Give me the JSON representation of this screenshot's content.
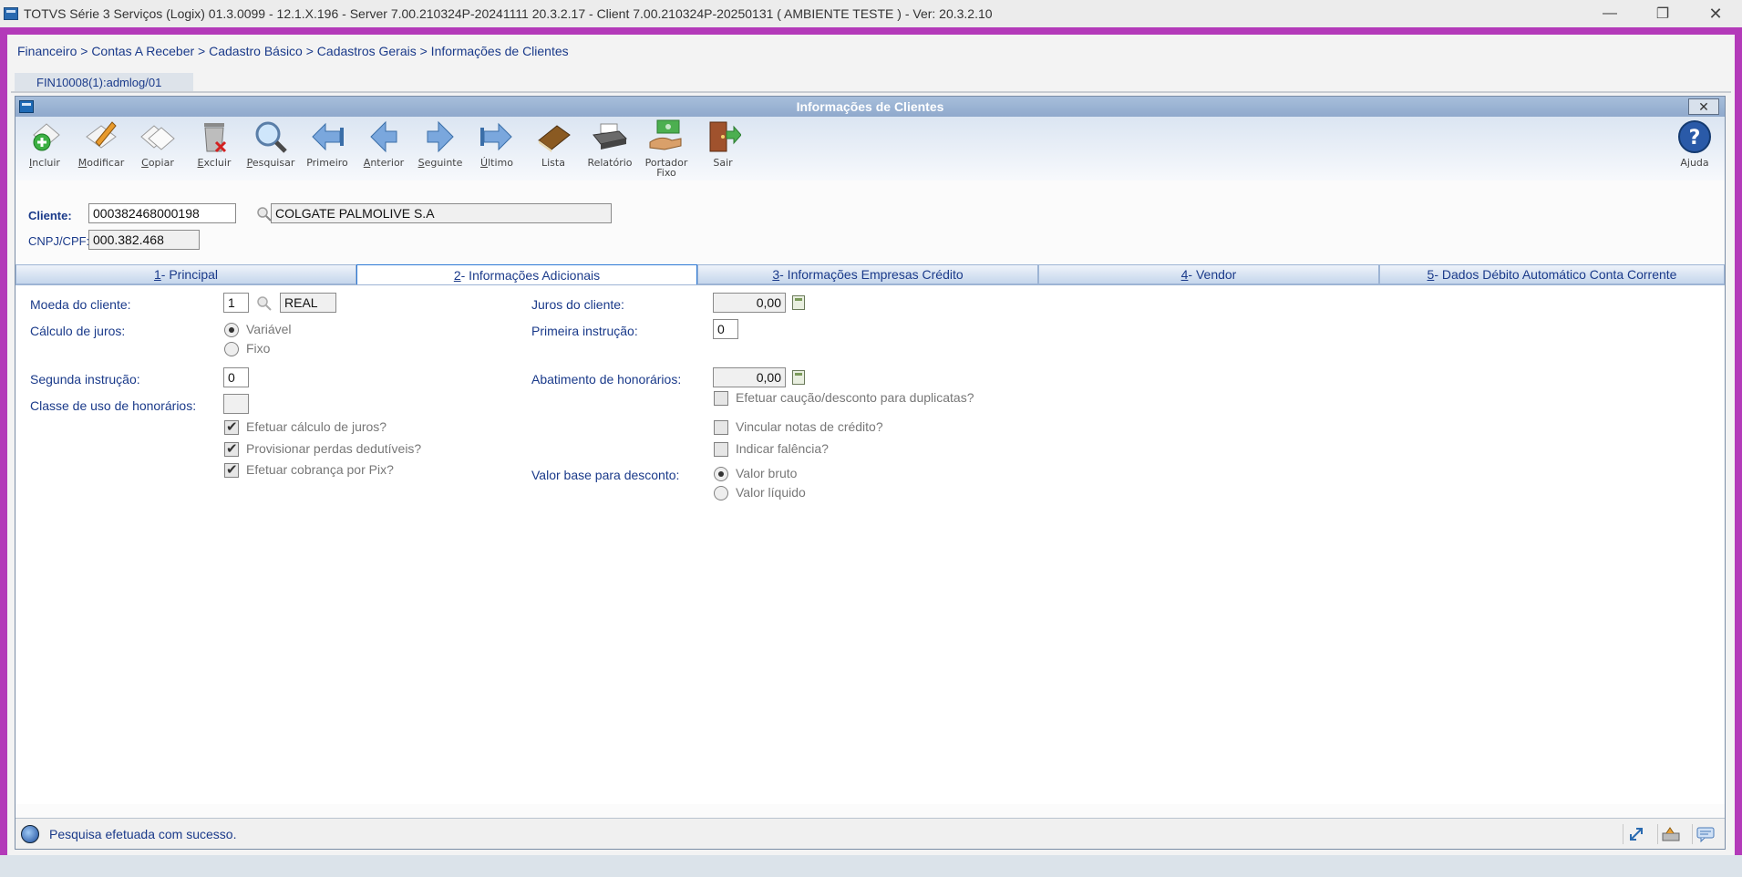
{
  "os": {
    "title": "TOTVS Série 3 Serviços (Logix) 01.3.0099  -  12.1.X.196 - Server 7.00.210324P-20241111 20.3.2.17 - Client 7.00.210324P-20250131    ( AMBIENTE TESTE )  - Ver: 20.3.2.10",
    "minimize": "—",
    "maximize": "❐",
    "close": "✕"
  },
  "breadcrumb": "Financeiro > Contas A Receber > Cadastro Básico > Cadastros Gerais > Informações de Clientes",
  "session_tab": "FIN10008(1):admlog/01",
  "window": {
    "title": "Informações de Clientes",
    "close": "✕"
  },
  "toolbar": [
    {
      "label": "Incluir",
      "icon": "add-document-icon"
    },
    {
      "label": "Modificar",
      "icon": "edit-document-icon"
    },
    {
      "label": "Copiar",
      "icon": "copy-document-icon"
    },
    {
      "label": "Excluir",
      "icon": "trash-icon"
    },
    {
      "label": "Pesquisar",
      "icon": "magnifier-icon"
    },
    {
      "label": "Primeiro",
      "icon": "first-arrow-icon"
    },
    {
      "label": "Anterior",
      "icon": "previous-arrow-icon"
    },
    {
      "label": "Seguinte",
      "icon": "next-arrow-icon"
    },
    {
      "label": "Último",
      "icon": "last-arrow-icon"
    },
    {
      "label": "Lista",
      "icon": "book-icon"
    },
    {
      "label": "Relatório",
      "icon": "printer-icon"
    },
    {
      "label": "Portador",
      "label2": "Fixo",
      "icon": "money-hand-icon"
    },
    {
      "label": "Sair",
      "icon": "exit-door-icon"
    },
    {
      "label": "Ajuda",
      "icon": "help-icon"
    }
  ],
  "header": {
    "cliente_label": "Cliente:",
    "cliente_code": "000382468000198",
    "cliente_name": "COLGATE PALMOLIVE S.A",
    "cnpj_label": "CNPJ/CPF:",
    "cnpj_value": "000.382.468"
  },
  "tabs": [
    {
      "num": "1",
      "label": " - Principal"
    },
    {
      "num": "2",
      "label": " - Informações Adicionais"
    },
    {
      "num": "3",
      "label": " - Informações Empresas Crédito"
    },
    {
      "num": "4",
      "label": " - Vendor"
    },
    {
      "num": "5",
      "label": " - Dados Débito Automático Conta Corrente"
    }
  ],
  "form": {
    "moeda_label": "Moeda do cliente:",
    "moeda_code": "1",
    "moeda_name": "REAL",
    "calculo_label": "Cálculo de  juros:",
    "calculo_opt1": "Variável",
    "calculo_opt2": "Fixo",
    "segunda_label": "Segunda instrução:",
    "segunda_value": "0",
    "classe_label": "Classe de uso de honorários:",
    "classe_value": "",
    "chk_juros": "Efetuar cálculo de juros?",
    "chk_perdas": "Provisionar perdas dedutíveis?",
    "chk_pix": "Efetuar cobrança por Pix?",
    "juros_label": "Juros do cliente:",
    "juros_value": "0,00",
    "primeira_label": "Primeira instrução:",
    "primeira_value": "0",
    "abatimento_label": "Abatimento de honorários:",
    "abatimento_value": "0,00",
    "chk_caucao": "Efetuar caução/desconto para duplicatas?",
    "chk_vincular": "Vincular notas de crédito?",
    "chk_falencia": "Indicar falência?",
    "valor_base_label": "Valor base para desconto:",
    "valor_opt1": "Valor bruto",
    "valor_opt2": "Valor líquido"
  },
  "status": {
    "message": "Pesquisa efetuada com sucesso."
  }
}
